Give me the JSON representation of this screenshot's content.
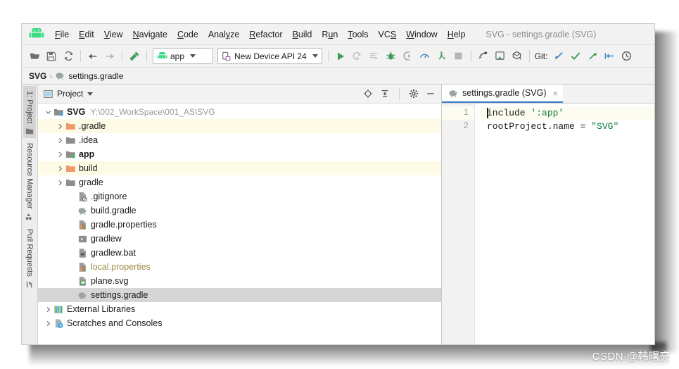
{
  "window": {
    "title": "SVG - settings.gradle (SVG)",
    "logo_icon": "android-logo-icon"
  },
  "menubar": {
    "items": [
      {
        "label": "File",
        "mnemonic": "F"
      },
      {
        "label": "Edit",
        "mnemonic": "E"
      },
      {
        "label": "View",
        "mnemonic": "V"
      },
      {
        "label": "Navigate",
        "mnemonic": "N"
      },
      {
        "label": "Code",
        "mnemonic": "C"
      },
      {
        "label": "Analyze",
        "mnemonic": "y"
      },
      {
        "label": "Refactor",
        "mnemonic": "R"
      },
      {
        "label": "Build",
        "mnemonic": "B"
      },
      {
        "label": "Run",
        "mnemonic": "u"
      },
      {
        "label": "Tools",
        "mnemonic": "T"
      },
      {
        "label": "VCS",
        "mnemonic": "S"
      },
      {
        "label": "Window",
        "mnemonic": "W"
      },
      {
        "label": "Help",
        "mnemonic": "H"
      }
    ]
  },
  "toolbar": {
    "icons_left": [
      "open-folder-icon",
      "save-icon",
      "sync-project-icon"
    ],
    "nav_icons": [
      "back-arrow-icon",
      "forward-arrow-icon"
    ],
    "build_icon": "build-hammer-icon",
    "module_combo": {
      "label": "app",
      "icon": "android-module-icon"
    },
    "device_combo": {
      "label": "New Device API 24",
      "icon": "device-icon"
    },
    "run_icons": [
      "run-icon",
      "apply-changes-icon",
      "apply-code-changes-icon",
      "debug-icon",
      "attach-debugger-icon",
      "stop-icon-disabled"
    ],
    "profiler_icons": [
      "profiler-icon",
      "avd-manager-icon"
    ],
    "stop_icon": "stop-icon",
    "tool_icons": [
      "sdk-manager-icon",
      "layout-inspector-icon",
      "gradle-sync-icon"
    ],
    "git_label": "Git:",
    "git_icons": [
      "update-project-icon",
      "commit-icon",
      "push-icon",
      "rollback-icon",
      "history-icon"
    ]
  },
  "navbar": {
    "root": "SVG",
    "separator": "›",
    "leaf": "settings.gradle",
    "leaf_icon": "gradle-elephant-icon"
  },
  "tool_window_tabs": [
    {
      "label": "1: Project",
      "icon": "project-icon",
      "active": true
    },
    {
      "label": "Resource Manager",
      "icon": "resource-manager-icon",
      "active": false
    },
    {
      "label": "Pull Requests",
      "icon": "pull-request-icon",
      "active": false
    }
  ],
  "project_panel": {
    "title": "Project",
    "header_icons": [
      "locate-icon",
      "collapse-all-icon",
      "settings-gear-icon",
      "hide-icon"
    ],
    "tree": [
      {
        "label": "SVG",
        "path": "Y:\\002_WorkSpace\\001_AS\\SVG",
        "depth": 0,
        "arrow": "expanded",
        "icon": "project-root-icon",
        "bold": true,
        "state": "normal"
      },
      {
        "label": ".gradle",
        "depth": 1,
        "arrow": "collapsed",
        "icon": "folder-orange-icon",
        "bold": false,
        "state": "excluded"
      },
      {
        "label": ".idea",
        "depth": 1,
        "arrow": "collapsed",
        "icon": "folder-gray-icon",
        "bold": false,
        "state": "normal"
      },
      {
        "label": "app",
        "depth": 1,
        "arrow": "collapsed",
        "icon": "module-folder-icon",
        "bold": true,
        "state": "normal"
      },
      {
        "label": "build",
        "depth": 1,
        "arrow": "collapsed",
        "icon": "folder-orange-icon",
        "bold": false,
        "state": "excluded"
      },
      {
        "label": "gradle",
        "depth": 1,
        "arrow": "collapsed",
        "icon": "folder-gray-icon",
        "bold": false,
        "state": "normal"
      },
      {
        "label": ".gitignore",
        "depth": 2,
        "arrow": "none",
        "icon": "gitignore-file-icon",
        "bold": false,
        "state": "normal"
      },
      {
        "label": "build.gradle",
        "depth": 2,
        "arrow": "none",
        "icon": "gradle-elephant-icon",
        "bold": false,
        "state": "normal"
      },
      {
        "label": "gradle.properties",
        "depth": 2,
        "arrow": "none",
        "icon": "properties-file-icon",
        "bold": false,
        "state": "normal"
      },
      {
        "label": "gradlew",
        "depth": 2,
        "arrow": "none",
        "icon": "shell-script-icon",
        "bold": false,
        "state": "normal"
      },
      {
        "label": "gradlew.bat",
        "depth": 2,
        "arrow": "none",
        "icon": "bat-file-icon",
        "bold": false,
        "state": "normal"
      },
      {
        "label": "local.properties",
        "depth": 2,
        "arrow": "none",
        "icon": "properties-file-icon",
        "bold": false,
        "state": "ignored"
      },
      {
        "label": "plane.svg",
        "depth": 2,
        "arrow": "none",
        "icon": "svg-file-icon",
        "bold": false,
        "state": "normal"
      },
      {
        "label": "settings.gradle",
        "depth": 2,
        "arrow": "none",
        "icon": "gradle-elephant-icon",
        "bold": false,
        "state": "selected"
      },
      {
        "label": "External Libraries",
        "depth": 0,
        "arrow": "collapsed",
        "icon": "libraries-icon",
        "bold": false,
        "state": "normal"
      },
      {
        "label": "Scratches and Consoles",
        "depth": 0,
        "arrow": "collapsed",
        "icon": "scratches-icon",
        "bold": false,
        "state": "normal"
      }
    ]
  },
  "editor": {
    "tab": {
      "label": "settings.gradle (SVG)",
      "icon": "gradle-elephant-icon",
      "close": "×"
    },
    "lines": [
      {
        "number": "1",
        "caret": true,
        "segments": [
          {
            "text": "include ",
            "type": "plain"
          },
          {
            "text": "':app'",
            "type": "string"
          }
        ]
      },
      {
        "number": "2",
        "caret": false,
        "segments": [
          {
            "text": "rootProject.name = ",
            "type": "plain"
          },
          {
            "text": "\"SVG\"",
            "type": "string"
          }
        ]
      }
    ]
  },
  "watermark": {
    "text": "CSDN @韩曙亮"
  },
  "colors": {
    "accent_blue": "#3a7cc4",
    "excluded_row": "#fdfbe5",
    "selected_row": "#d6d6d6",
    "string_green": "#0b7d3e",
    "ignored_text": "#9a8c4a",
    "android_green": "#3ddc84"
  }
}
